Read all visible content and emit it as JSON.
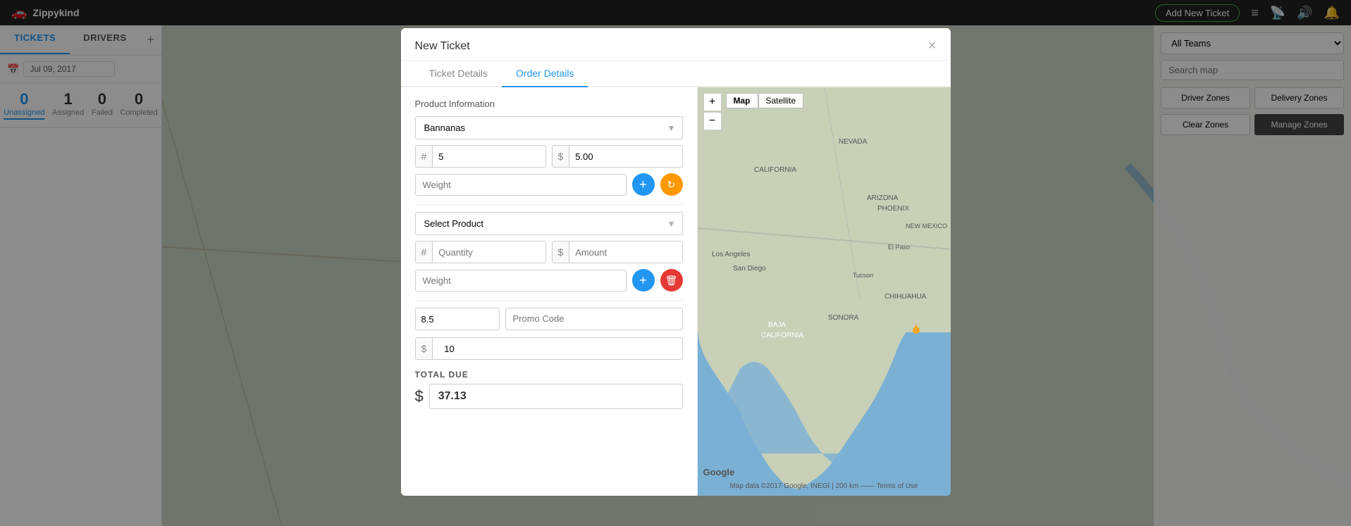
{
  "app": {
    "name": "Zippykind",
    "logo_icon": "🚗"
  },
  "topnav": {
    "add_new_ticket": "Add New Ticket",
    "menu_icon": "≡",
    "radio_icon": "📡",
    "volume_icon": "🔊",
    "bell_icon": "🔔"
  },
  "sidebar": {
    "tabs": [
      {
        "label": "TICKETS",
        "active": true
      },
      {
        "label": "DRIVERS",
        "active": false
      }
    ],
    "plus_icon": "+",
    "date_value": "Jul 09, 2017",
    "date_placeholder": "Jul 09, 2017",
    "stats": [
      {
        "number": "0",
        "label": "Unassigned",
        "active": true,
        "color": "blue"
      },
      {
        "number": "1",
        "label": "Assigned",
        "active": false,
        "color": "dark"
      },
      {
        "number": "0",
        "label": "Failed",
        "active": false,
        "color": "dark"
      },
      {
        "number": "0",
        "label": "Completed",
        "active": false,
        "color": "dark"
      }
    ]
  },
  "right_panel": {
    "team_select": {
      "value": "All Teams",
      "options": [
        "All Teams"
      ]
    },
    "search_placeholder": "Search map",
    "zone_buttons": [
      {
        "label": "Driver Zones",
        "dark": false
      },
      {
        "label": "Delivery Zones",
        "dark": false
      }
    ],
    "zone_buttons2": [
      {
        "label": "Clear Zones",
        "dark": false
      },
      {
        "label": "Manage Zones",
        "dark": true
      }
    ]
  },
  "modal": {
    "title": "New Ticket",
    "close_icon": "×",
    "tabs": [
      {
        "label": "Ticket Details",
        "active": false
      },
      {
        "label": "Order Details",
        "active": true
      }
    ],
    "form": {
      "section_title": "Product Information",
      "product1": {
        "select_value": "Bannanas",
        "select_options": [
          "Bannanas"
        ],
        "quantity_prefix": "#",
        "quantity_value": "5",
        "price_prefix": "$",
        "price_value": "5.00",
        "weight_placeholder": "Weight",
        "add_icon": "+",
        "refresh_icon": "↻"
      },
      "product2": {
        "select_placeholder": "Select Product",
        "select_options": [],
        "quantity_prefix": "#",
        "quantity_placeholder": "Quantity",
        "price_prefix": "$",
        "price_placeholder": "Amount",
        "weight_placeholder": "Weight",
        "add_icon": "+",
        "delete_icon": "🗑"
      },
      "tax_value": "8.5",
      "tax_suffix": "%",
      "promo_placeholder": "Promo Code",
      "tip_prefix": "$",
      "tip_value": "10",
      "total_label": "TOTAL DUE",
      "total_dollar": "$",
      "total_value": "37.13"
    },
    "map": {
      "plus_ctrl": "+",
      "minus_ctrl": "−",
      "map_label": "Map",
      "satellite_label": "Satellite",
      "google_logo": "Google",
      "attribution": "Map data ©2017 Google, INEGI  |  200 km  ——  Terms of Use"
    }
  }
}
